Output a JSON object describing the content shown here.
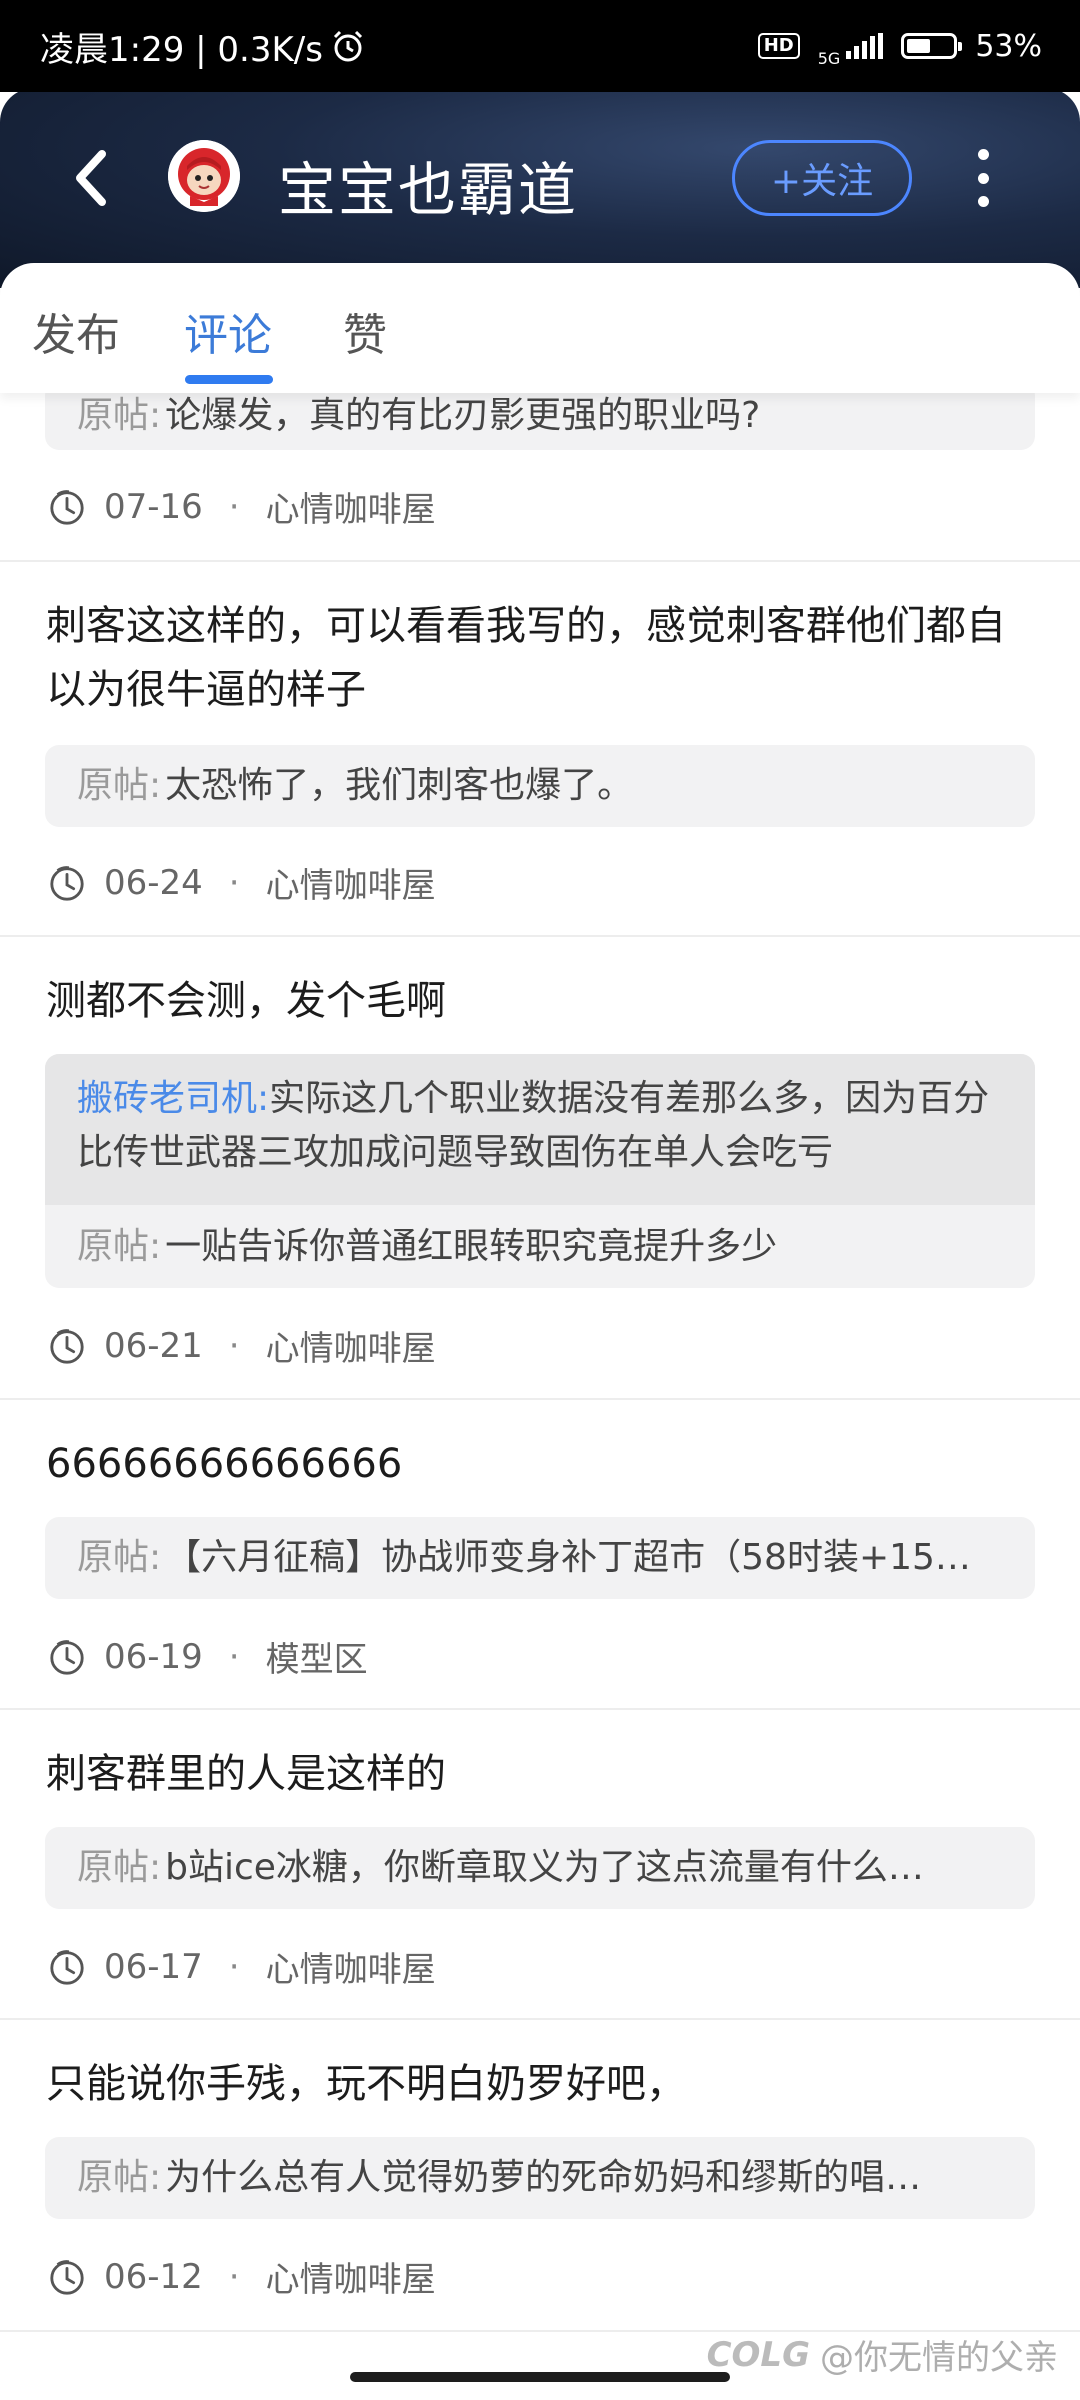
{
  "status_bar": {
    "time_speed": "凌晨1:29 | 0.3K/s",
    "hd": "HD",
    "network": "5G",
    "battery": "53%",
    "battery_level": 0.53
  },
  "header": {
    "username": "宝宝也霸道",
    "follow_label": "+关注"
  },
  "tabs": [
    {
      "label": "发布"
    },
    {
      "label": "评论"
    },
    {
      "label": "赞"
    }
  ],
  "ref_label": "原帖:",
  "items": [
    {
      "comment": "",
      "ref_text": "论爆发，真的有比刃影更强的职业吗?",
      "date": "07-16",
      "forum": "心情咖啡屋"
    },
    {
      "comment": "刺客这这样的，可以看看我写的，感觉刺客群他们都自以为很牛逼的样子",
      "ref_text": "太恐怖了，我们刺客也爆了。",
      "date": "06-24",
      "forum": "心情咖啡屋"
    },
    {
      "comment": "测都不会测，发个毛啊",
      "reply_user": "搬砖老司机:",
      "reply_text": "实际这几个职业数据没有差那么多，因为百分比传世武器三攻加成问题导致固伤在单人会吃亏",
      "ref_text": "一贴告诉你普通红眼转职究竟提升多少",
      "date": "06-21",
      "forum": "心情咖啡屋"
    },
    {
      "comment": "66666666666666",
      "ref_text": "【六月征稿】协战师变身补丁超市（58时装+15…",
      "date": "06-19",
      "forum": "模型区"
    },
    {
      "comment": "刺客群里的人是这样的",
      "ref_text": "b站ice冰糖，你断章取义为了这点流量有什么…",
      "date": "06-17",
      "forum": "心情咖啡屋"
    },
    {
      "comment": "只能说你手残，玩不明白奶罗好吧，",
      "ref_text": "为什么总有人觉得奶萝的死命奶妈和缪斯的唱…",
      "date": "06-12",
      "forum": "心情咖啡屋"
    }
  ],
  "watermark": {
    "logo": "COLG",
    "text": "@你无情的父亲"
  }
}
